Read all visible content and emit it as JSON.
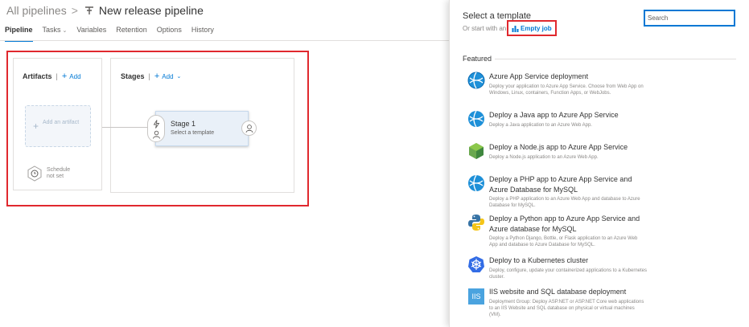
{
  "breadcrumb": {
    "root": "All pipelines",
    "separator": ">",
    "title": "New release pipeline",
    "pipeline_icon": "pipeline-icon"
  },
  "tabs": [
    {
      "label": "Pipeline",
      "active": true
    },
    {
      "label": "Tasks",
      "dropdown": true
    },
    {
      "label": "Variables"
    },
    {
      "label": "Retention"
    },
    {
      "label": "Options"
    },
    {
      "label": "History"
    }
  ],
  "artifacts": {
    "title": "Artifacts",
    "separator": "|",
    "add_label": "Add",
    "add_artifact": "Add an artifact",
    "schedule": "Schedule not set",
    "schedule_icon": "clock-icon"
  },
  "stages": {
    "title": "Stages",
    "separator": "|",
    "add_label": "Add",
    "stage_name": "Stage 1",
    "stage_sub": "Select a template",
    "pre_icons": [
      "lightning-icon",
      "person-icon"
    ],
    "post_icon": "person-icon"
  },
  "template_panel": {
    "title": "Select a template",
    "start_with": "Or start with an",
    "empty_job": "Empty job",
    "search_placeholder": "Search",
    "featured": "Featured",
    "templates": [
      {
        "title": "Azure App Service deployment",
        "desc": "Deploy your application to Azure App Service. Choose from Web App on Windows, Linux, containers, Function Apps, or WebJobs.",
        "icon": "azure-app-service-icon"
      },
      {
        "title": "Deploy a Java app to Azure App Service",
        "desc": "Deploy a Java application to an Azure Web App.",
        "icon": "azure-app-service-icon"
      },
      {
        "title": "Deploy a Node.js app to Azure App Service",
        "desc": "Deploy a Node.js application to an Azure Web App.",
        "icon": "nodejs-icon"
      },
      {
        "title": "Deploy a PHP app to Azure App Service and Azure Database for MySQL",
        "desc": "Deploy a PHP application to an Azure Web App and database to Azure Database for MySQL.",
        "icon": "azure-app-service-icon"
      },
      {
        "title": "Deploy a Python app to Azure App Service and Azure database for MySQL",
        "desc": "Deploy a Python Django, Bottle, or Flask application to an Azure Web App and database to Azure Database for MySQL.",
        "icon": "python-icon"
      },
      {
        "title": "Deploy to a Kubernetes cluster",
        "desc": "Deploy, configure, update your containerized applications to a Kubernetes cluster.",
        "icon": "kubernetes-icon"
      },
      {
        "title": "IIS website and SQL database deployment",
        "desc": "Deployment Group: Deploy ASP.NET or ASP.NET Core web applications to an IIS Website and SQL database on physical or virtual machines (VM).",
        "icon": "iis-icon",
        "icon_text": "IIS"
      }
    ]
  },
  "colors": {
    "accent": "#0078d4",
    "highlight": "#e0282e",
    "stage_fill": "#e9f0f8"
  }
}
